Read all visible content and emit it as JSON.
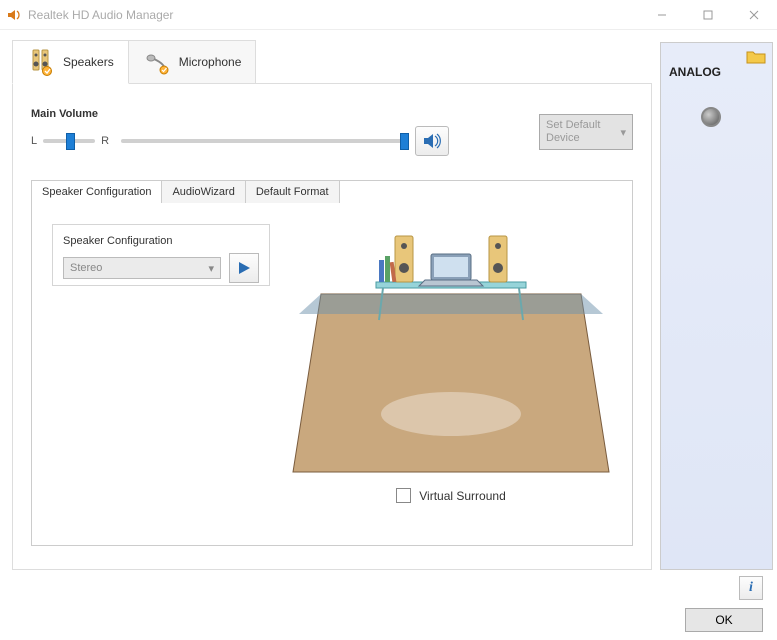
{
  "title": "Realtek HD Audio Manager",
  "device_tabs": {
    "speakers": "Speakers",
    "microphone": "Microphone"
  },
  "volume": {
    "label": "Main Volume",
    "l": "L",
    "r": "R",
    "balance_pct": 50,
    "level_pct": 100
  },
  "default_button": "Set Default Device",
  "inner_tabs": {
    "speaker_config": "Speaker Configuration",
    "audiowizard": "AudioWizard",
    "default_format": "Default Format"
  },
  "speaker_config": {
    "label": "Speaker Configuration",
    "selected": "Stereo"
  },
  "virtual_surround": "Virtual Surround",
  "right_panel": {
    "label": "ANALOG"
  },
  "buttons": {
    "ok": "OK",
    "info": "i"
  }
}
